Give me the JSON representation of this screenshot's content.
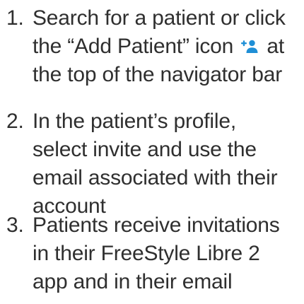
{
  "steps": [
    {
      "number": "1.",
      "lines": [
        "Search for a patient or click",
        "the “Add Patient” icon",
        "at",
        "the top of the navigator bar"
      ],
      "icon": "add-patient-icon"
    },
    {
      "number": "2.",
      "lines": [
        "In the patient’s profile,",
        "select invite and use the",
        "email associated with their",
        "account"
      ]
    },
    {
      "number": "3.",
      "lines": [
        "Patients receive invitations",
        "in their FreeStyle Libre 2",
        "app and in their email"
      ]
    }
  ],
  "colors": {
    "text": "#2f2f2f",
    "icon": "#1f8fd6"
  }
}
